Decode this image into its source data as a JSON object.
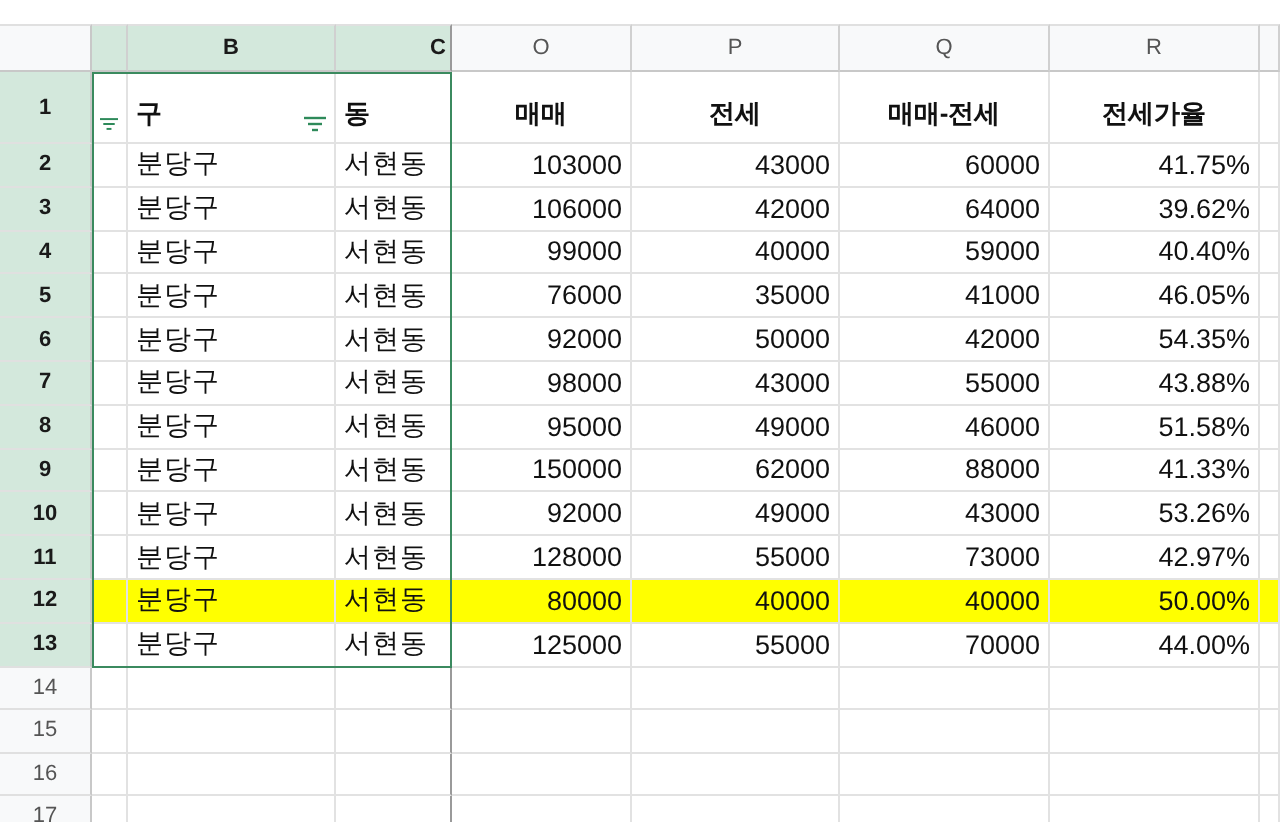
{
  "columns": [
    {
      "letter": "B",
      "selected": true
    },
    {
      "letter": "C",
      "selected": true
    },
    {
      "letter": "O",
      "selected": false
    },
    {
      "letter": "P",
      "selected": false
    },
    {
      "letter": "Q",
      "selected": false
    },
    {
      "letter": "R",
      "selected": false
    }
  ],
  "rows": [
    {
      "number": "1",
      "kind": "header",
      "selected": true,
      "highlighted": false,
      "filtered": true,
      "cells": [
        "구",
        "동",
        "매매",
        "전세",
        "매매-전세",
        "전세가율"
      ]
    },
    {
      "number": "2",
      "kind": "data",
      "selected": true,
      "highlighted": false,
      "cells": [
        "분당구",
        "서현동",
        "103000",
        "43000",
        "60000",
        "41.75%"
      ]
    },
    {
      "number": "3",
      "kind": "data",
      "selected": true,
      "highlighted": false,
      "cells": [
        "분당구",
        "서현동",
        "106000",
        "42000",
        "64000",
        "39.62%"
      ]
    },
    {
      "number": "4",
      "kind": "data",
      "selected": true,
      "highlighted": false,
      "cells": [
        "분당구",
        "서현동",
        "99000",
        "40000",
        "59000",
        "40.40%"
      ]
    },
    {
      "number": "5",
      "kind": "data",
      "selected": true,
      "highlighted": false,
      "cells": [
        "분당구",
        "서현동",
        "76000",
        "35000",
        "41000",
        "46.05%"
      ]
    },
    {
      "number": "6",
      "kind": "data",
      "selected": true,
      "highlighted": false,
      "cells": [
        "분당구",
        "서현동",
        "92000",
        "50000",
        "42000",
        "54.35%"
      ]
    },
    {
      "number": "7",
      "kind": "data",
      "selected": true,
      "highlighted": false,
      "cells": [
        "분당구",
        "서현동",
        "98000",
        "43000",
        "55000",
        "43.88%"
      ]
    },
    {
      "number": "8",
      "kind": "data",
      "selected": true,
      "highlighted": false,
      "cells": [
        "분당구",
        "서현동",
        "95000",
        "49000",
        "46000",
        "51.58%"
      ]
    },
    {
      "number": "9",
      "kind": "data",
      "selected": true,
      "highlighted": false,
      "cells": [
        "분당구",
        "서현동",
        "150000",
        "62000",
        "88000",
        "41.33%"
      ]
    },
    {
      "number": "10",
      "kind": "data",
      "selected": true,
      "highlighted": false,
      "cells": [
        "분당구",
        "서현동",
        "92000",
        "49000",
        "43000",
        "53.26%"
      ]
    },
    {
      "number": "11",
      "kind": "data",
      "selected": true,
      "highlighted": false,
      "cells": [
        "분당구",
        "서현동",
        "128000",
        "55000",
        "73000",
        "42.97%"
      ]
    },
    {
      "number": "12",
      "kind": "data",
      "selected": true,
      "highlighted": true,
      "cells": [
        "분당구",
        "서현동",
        "80000",
        "40000",
        "40000",
        "50.00%"
      ]
    },
    {
      "number": "13",
      "kind": "data",
      "selected": true,
      "highlighted": false,
      "cells": [
        "분당구",
        "서현동",
        "125000",
        "55000",
        "70000",
        "44.00%"
      ]
    },
    {
      "number": "14",
      "kind": "empty",
      "selected": false,
      "highlighted": false
    },
    {
      "number": "15",
      "kind": "empty",
      "selected": false,
      "highlighted": false
    },
    {
      "number": "16",
      "kind": "empty",
      "selected": false,
      "highlighted": false
    },
    {
      "number": "17",
      "kind": "empty",
      "selected": false,
      "highlighted": false
    }
  ]
}
